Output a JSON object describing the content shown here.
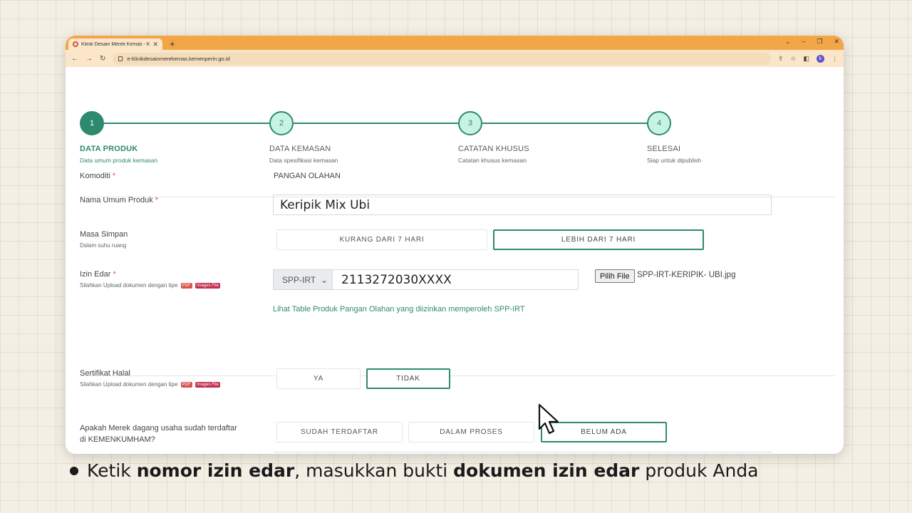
{
  "browser": {
    "tab_title": "Klinik Desain Merek Kemas - Kementerian",
    "url": "e-klinikdesainmerekemas.kemenperin.go.id",
    "profile_initial": "k",
    "accent_color": "#f3a648"
  },
  "stepper": {
    "steps": [
      {
        "number": "1",
        "title": "DATA PRODUK",
        "subtitle": "Data umum produk kemasan",
        "active": true
      },
      {
        "number": "2",
        "title": "DATA KEMASAN",
        "subtitle": "Data spesifikasi kemasan",
        "active": false
      },
      {
        "number": "3",
        "title": "CATATAN KHUSUS",
        "subtitle": "Catatan khusus kemasan",
        "active": false
      },
      {
        "number": "4",
        "title": "SELESAI",
        "subtitle": "Siap untuk dipublish",
        "active": false
      }
    ]
  },
  "form": {
    "komoditi": {
      "label": "Komoditi",
      "required": "*",
      "value": "PANGAN OLAHAN"
    },
    "nama_produk": {
      "label": "Nama Umum Produk",
      "required": "*",
      "value": "Keripik Mix Ubi"
    },
    "masa_simpan": {
      "label": "Masa Simpan",
      "sublabel": "Dalam suhu ruang",
      "options": [
        "KURANG DARI 7 HARI",
        "LEBIH DARI 7 HARI"
      ],
      "selected": "LEBIH DARI 7 HARI"
    },
    "izin_edar": {
      "label": "Izin Edar",
      "required": "*",
      "sublabel": "Silahkan Upload dokumen dengan tipe",
      "badge_pdf": "PDF",
      "badge_images": "Images File",
      "type_selected": "SPP-IRT",
      "number_value": "2113272030XXXX",
      "file_button": "Pilih File",
      "file_name": "SPP-IRT-KERIPIK- UBI.jpg",
      "link_text": "Lihat Table Produk Pangan Olahan yang diizinkan memperoleh SPP-IRT"
    },
    "sertifikat_halal": {
      "label": "Sertifikat Halal",
      "sublabel": "Silahkan Upload dokumen dengan tipe",
      "badge_pdf": "PDF",
      "badge_images": "Images File",
      "options": [
        "YA",
        "TIDAK"
      ],
      "selected": "TIDAK"
    },
    "merek": {
      "label_line1": "Apakah Merek dagang usaha sudah terdaftar",
      "label_line2": "di KEMENKUMHAM?",
      "options": [
        "SUDAH TERDAFTAR",
        "DALAM PROSES",
        "BELUM ADA"
      ],
      "selected": "BELUM ADA"
    }
  },
  "caption": {
    "part1": "Ketik ",
    "bold1": "nomor izin edar",
    "part2": ", masukkan bukti ",
    "bold2": "dokumen izin edar",
    "part3": " produk Anda"
  },
  "colors": {
    "primary_green": "#2e8a6e",
    "step_fill": "#c8f3e3",
    "background": "#f4efe4"
  }
}
